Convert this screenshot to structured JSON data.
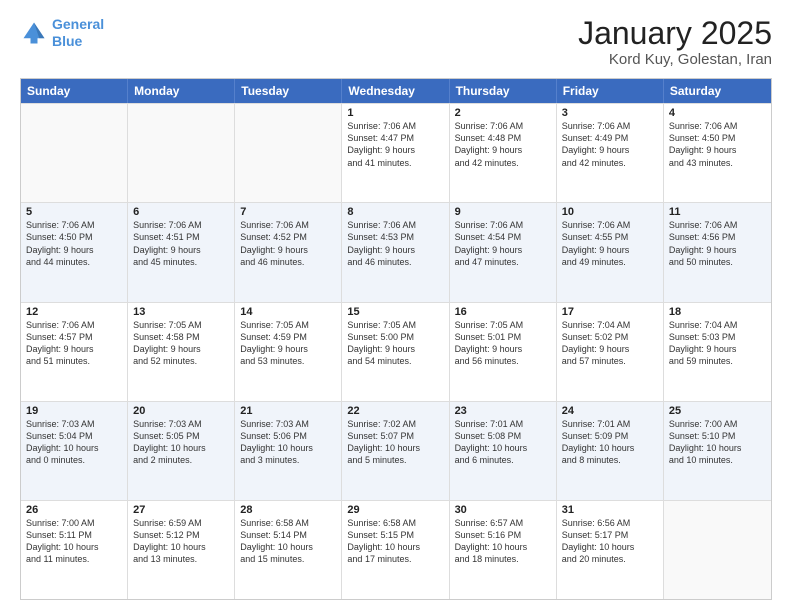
{
  "logo": {
    "line1": "General",
    "line2": "Blue"
  },
  "title": "January 2025",
  "subtitle": "Kord Kuy, Golestan, Iran",
  "header_days": [
    "Sunday",
    "Monday",
    "Tuesday",
    "Wednesday",
    "Thursday",
    "Friday",
    "Saturday"
  ],
  "rows": [
    [
      {
        "day": "",
        "info": ""
      },
      {
        "day": "",
        "info": ""
      },
      {
        "day": "",
        "info": ""
      },
      {
        "day": "1",
        "info": "Sunrise: 7:06 AM\nSunset: 4:47 PM\nDaylight: 9 hours\nand 41 minutes."
      },
      {
        "day": "2",
        "info": "Sunrise: 7:06 AM\nSunset: 4:48 PM\nDaylight: 9 hours\nand 42 minutes."
      },
      {
        "day": "3",
        "info": "Sunrise: 7:06 AM\nSunset: 4:49 PM\nDaylight: 9 hours\nand 42 minutes."
      },
      {
        "day": "4",
        "info": "Sunrise: 7:06 AM\nSunset: 4:50 PM\nDaylight: 9 hours\nand 43 minutes."
      }
    ],
    [
      {
        "day": "5",
        "info": "Sunrise: 7:06 AM\nSunset: 4:50 PM\nDaylight: 9 hours\nand 44 minutes."
      },
      {
        "day": "6",
        "info": "Sunrise: 7:06 AM\nSunset: 4:51 PM\nDaylight: 9 hours\nand 45 minutes."
      },
      {
        "day": "7",
        "info": "Sunrise: 7:06 AM\nSunset: 4:52 PM\nDaylight: 9 hours\nand 46 minutes."
      },
      {
        "day": "8",
        "info": "Sunrise: 7:06 AM\nSunset: 4:53 PM\nDaylight: 9 hours\nand 46 minutes."
      },
      {
        "day": "9",
        "info": "Sunrise: 7:06 AM\nSunset: 4:54 PM\nDaylight: 9 hours\nand 47 minutes."
      },
      {
        "day": "10",
        "info": "Sunrise: 7:06 AM\nSunset: 4:55 PM\nDaylight: 9 hours\nand 49 minutes."
      },
      {
        "day": "11",
        "info": "Sunrise: 7:06 AM\nSunset: 4:56 PM\nDaylight: 9 hours\nand 50 minutes."
      }
    ],
    [
      {
        "day": "12",
        "info": "Sunrise: 7:06 AM\nSunset: 4:57 PM\nDaylight: 9 hours\nand 51 minutes."
      },
      {
        "day": "13",
        "info": "Sunrise: 7:05 AM\nSunset: 4:58 PM\nDaylight: 9 hours\nand 52 minutes."
      },
      {
        "day": "14",
        "info": "Sunrise: 7:05 AM\nSunset: 4:59 PM\nDaylight: 9 hours\nand 53 minutes."
      },
      {
        "day": "15",
        "info": "Sunrise: 7:05 AM\nSunset: 5:00 PM\nDaylight: 9 hours\nand 54 minutes."
      },
      {
        "day": "16",
        "info": "Sunrise: 7:05 AM\nSunset: 5:01 PM\nDaylight: 9 hours\nand 56 minutes."
      },
      {
        "day": "17",
        "info": "Sunrise: 7:04 AM\nSunset: 5:02 PM\nDaylight: 9 hours\nand 57 minutes."
      },
      {
        "day": "18",
        "info": "Sunrise: 7:04 AM\nSunset: 5:03 PM\nDaylight: 9 hours\nand 59 minutes."
      }
    ],
    [
      {
        "day": "19",
        "info": "Sunrise: 7:03 AM\nSunset: 5:04 PM\nDaylight: 10 hours\nand 0 minutes."
      },
      {
        "day": "20",
        "info": "Sunrise: 7:03 AM\nSunset: 5:05 PM\nDaylight: 10 hours\nand 2 minutes."
      },
      {
        "day": "21",
        "info": "Sunrise: 7:03 AM\nSunset: 5:06 PM\nDaylight: 10 hours\nand 3 minutes."
      },
      {
        "day": "22",
        "info": "Sunrise: 7:02 AM\nSunset: 5:07 PM\nDaylight: 10 hours\nand 5 minutes."
      },
      {
        "day": "23",
        "info": "Sunrise: 7:01 AM\nSunset: 5:08 PM\nDaylight: 10 hours\nand 6 minutes."
      },
      {
        "day": "24",
        "info": "Sunrise: 7:01 AM\nSunset: 5:09 PM\nDaylight: 10 hours\nand 8 minutes."
      },
      {
        "day": "25",
        "info": "Sunrise: 7:00 AM\nSunset: 5:10 PM\nDaylight: 10 hours\nand 10 minutes."
      }
    ],
    [
      {
        "day": "26",
        "info": "Sunrise: 7:00 AM\nSunset: 5:11 PM\nDaylight: 10 hours\nand 11 minutes."
      },
      {
        "day": "27",
        "info": "Sunrise: 6:59 AM\nSunset: 5:12 PM\nDaylight: 10 hours\nand 13 minutes."
      },
      {
        "day": "28",
        "info": "Sunrise: 6:58 AM\nSunset: 5:14 PM\nDaylight: 10 hours\nand 15 minutes."
      },
      {
        "day": "29",
        "info": "Sunrise: 6:58 AM\nSunset: 5:15 PM\nDaylight: 10 hours\nand 17 minutes."
      },
      {
        "day": "30",
        "info": "Sunrise: 6:57 AM\nSunset: 5:16 PM\nDaylight: 10 hours\nand 18 minutes."
      },
      {
        "day": "31",
        "info": "Sunrise: 6:56 AM\nSunset: 5:17 PM\nDaylight: 10 hours\nand 20 minutes."
      },
      {
        "day": "",
        "info": ""
      }
    ]
  ]
}
